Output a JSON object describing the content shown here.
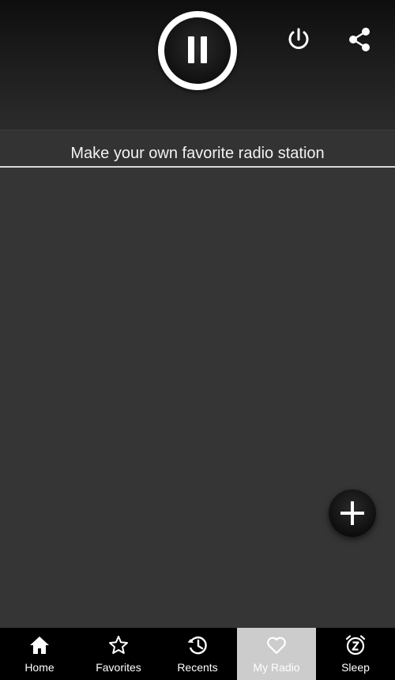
{
  "header": {
    "play_button_state": "paused",
    "play_icon": "pause-icon",
    "power_icon": "power-icon",
    "share_icon": "share-icon"
  },
  "caption": {
    "text": "Make your own favorite radio station"
  },
  "fab": {
    "icon": "plus-icon"
  },
  "bottom_nav": {
    "items": [
      {
        "label": "Home",
        "icon": "home-icon",
        "active": false
      },
      {
        "label": "Favorites",
        "icon": "star-icon",
        "active": false
      },
      {
        "label": "Recents",
        "icon": "history-icon",
        "active": false
      },
      {
        "label": "My Radio",
        "icon": "heart-icon",
        "active": true
      },
      {
        "label": "Sleep",
        "icon": "alarm-z-icon",
        "active": false
      }
    ]
  },
  "colors": {
    "background": "#353535",
    "active_tab": "#cccccc",
    "nav_background": "#000000",
    "text": "#ffffff"
  }
}
